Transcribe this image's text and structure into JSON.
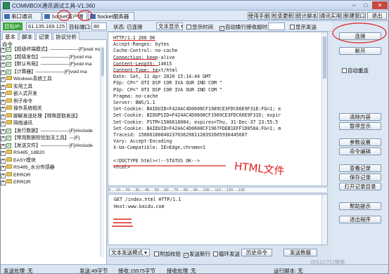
{
  "window": {
    "title": "COMMBOX通讯调试工具-V1.360",
    "minimize": "–",
    "maximize": "□",
    "close": "✕"
  },
  "main_tabs": [
    {
      "label": "串口通讯",
      "active": false
    },
    {
      "label": "Socket客户端",
      "active": true
    },
    {
      "label": "Socket服务器",
      "active": false
    }
  ],
  "top_buttons": {
    "manual": "使用手册",
    "update": "检查更新",
    "stats": "统计脚本",
    "tools": "通讯实用",
    "new_window": "新建窗口",
    "exit": "退出"
  },
  "connection": {
    "target_label": "目标IP:",
    "target_ip": "61.135.169.125",
    "port_label": "目标端口:",
    "port": "80",
    "status_label": "状态: 已连接",
    "text_mode": "文本显示",
    "show_time": "显示时间",
    "auto_wrap": "自动换行",
    "timeout_label": "接收超时:",
    "timeout": "",
    "show_send": "显示发送"
  },
  "left_panel": {
    "tabs": [
      "基本",
      "脚本",
      "记录",
      "协议分析"
    ],
    "header": "命令",
    "tree": [
      {
        "type": "cmd",
        "text": "【超级终端模式】——————[F]void ma"
      },
      {
        "type": "cmd",
        "text": "【超级发包】——————[F]void ma"
      },
      {
        "type": "cmd",
        "text": "【默认布局】——————[F]void ma"
      },
      {
        "type": "cmd",
        "text": "【计算器】——————[F]void ma"
      },
      {
        "type": "folder",
        "text": "Windows系统工具"
      },
      {
        "type": "folder",
        "text": "实用工具"
      },
      {
        "type": "folder",
        "text": "嵌入式开发"
      },
      {
        "type": "folder",
        "text": "例子命令"
      },
      {
        "type": "folder",
        "text": "操作系统相关"
      },
      {
        "type": "folder",
        "text": "脚解发送处理【特殊提取发送】"
      },
      {
        "type": "folder",
        "text": "网络通讯"
      },
      {
        "type": "cmd",
        "text": "【发行数据】——————[F]#include"
      },
      {
        "type": "cmd",
        "text": "【常用数据校验加法工具】—[F]"
      },
      {
        "type": "cmd",
        "text": "【发送文件】——————[F]#include"
      },
      {
        "type": "folder",
        "text": "RS485_18B20"
      },
      {
        "type": "folder",
        "text": "EASY模块"
      },
      {
        "type": "folder",
        "text": "RS485_水分传感器"
      },
      {
        "type": "folder",
        "text": "ERROR"
      },
      {
        "type": "folder",
        "text": "ERROR"
      }
    ]
  },
  "response": {
    "lines": [
      "HTTP/1.1 200 OK",
      "Accept-Ranges: bytes",
      "Cache-Control: no-cache",
      "Connection: keep-alive",
      "Content-Length: 14615",
      "Content-Type: text/html",
      "Date: Sat, 11 Apr 2020 15:14:44 GMT",
      "P3p: CP=\" OTI DSP COR IVA OUR IND COM \"",
      "P3p: CP=\" OTI DSP COR IVA OUR IND COM \"",
      "Pragma: no-cache",
      "Server: BWS/1.1",
      "Set-Cookie: BAIDUID=F424AC4D0608CF1989CE3FDC66E9F31D:FG=1; e",
      "Set-Cookie: BIDUPSID=F424AC4D0608CF1989CE3FDC66E9F31D; expir",
      "Set-Cookie: PSTM=1586618084; expires=Thu, 31-Dec-37 23:55:5",
      "Set-Cookie: BAIDUID=F424AC4D0608CF1967FDEB1EFF1D058A:FG=1; m",
      "Traceid: 158661808402370362981128392605936445687",
      "Vary: Accept-Encoding",
      "X-Ua-Compatible: IE=Edge,chrome=1",
      "",
      "<!DOCTYPE html><!--STATUS OK-->",
      "<html>"
    ],
    "annotation_1": "一",
    "annotation_2": "HTML文件"
  },
  "ruler_text": "0.....10.....20.....30.....40.....50.....60.....70.....80.....90.....100.....110.....120.....130",
  "request": {
    "lines": [
      "GET /index.html HTTP/1.1",
      "Host:www.baidu.com",
      "",
      ""
    ],
    "annotation": "三"
  },
  "send_bar": {
    "text_mode": "文本发送模式",
    "add_checksum": "附加校验",
    "auto_send": "发送新行",
    "loop_send": "循环发送",
    "history": "历史命令",
    "send": "发送数据"
  },
  "right_panel": {
    "connect": "连接",
    "disconnect": "断开",
    "auto_reconnect": "自动重连",
    "clear_display": "清除内容",
    "pause_display": "暂停显示",
    "param_settings": "参数设置",
    "cmd_edit": "命令编辑",
    "view_record": "查看记录",
    "save_record": "保存记录",
    "open_log": "打开记录目录",
    "help": "帮助提示",
    "quit": "退出程序",
    "annotation": "二"
  },
  "status_bar": {
    "send_process": "发送处理: 无",
    "send_bytes": "发送:49字节",
    "recv_bytes": "接收:15575字节",
    "recv_process": "接收处理: 无",
    "run_script": "运行脚本: 无"
  },
  "watermark": "@51CTO博客",
  "colors": {
    "annotation_red": "#e02020",
    "window_bg": "#d9e4f1",
    "panel_blue": "#dce7f4"
  }
}
